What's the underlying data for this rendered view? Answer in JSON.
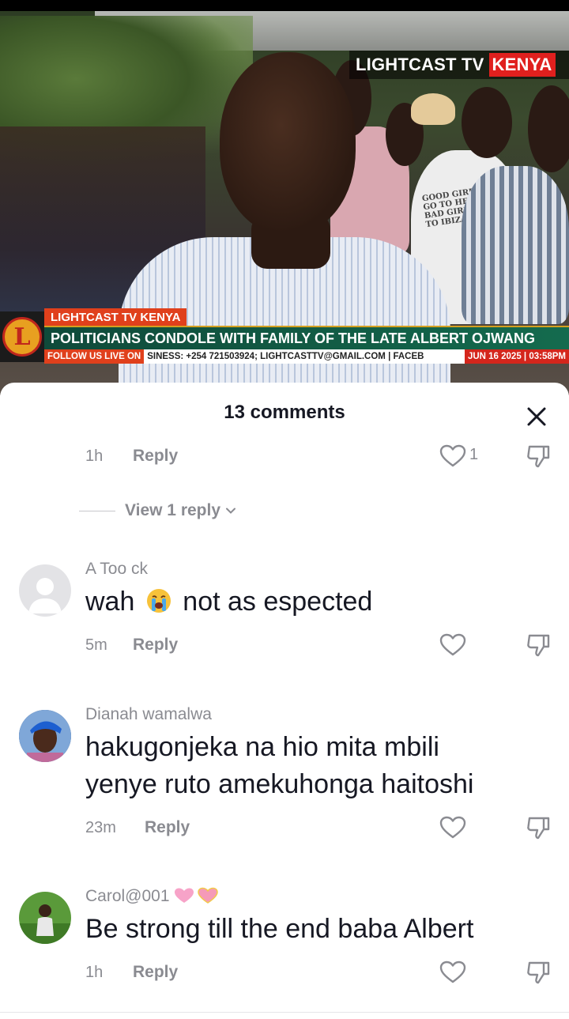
{
  "video": {
    "watermark_left": "LIGHTCAST TV",
    "watermark_right": "KENYA",
    "logo_letter": "L",
    "ticker_label": "LIGHTCAST TV KENYA",
    "headline": "POLITICIANS CONDOLE WITH FAMILY OF THE LATE ALBERT OJWANG",
    "follow": "FOLLOW US LIVE ON",
    "info": "SINESS: +254 721503924; LIGHTCASTTV@GMAIL.COM | FACEB",
    "date": "JUN 16 2025 | 03:58PM",
    "shirt_print": "GOOD GIRLS GO TO HEAVEN BAD GIRLS GO TO IBIZA"
  },
  "sheet": {
    "title": "13 comments",
    "close_icon": "close-icon"
  },
  "previous_comment": {
    "time": "1h",
    "reply_label": "Reply",
    "like_count": "1"
  },
  "view_replies": {
    "label": "View 1 reply"
  },
  "comments": [
    {
      "username": "A Too ck",
      "text_before": "wah",
      "emoji": "loudly-crying-face",
      "text_after": "not as espected",
      "time": "5m",
      "reply_label": "Reply"
    },
    {
      "username": "Dianah wamalwa",
      "text_line1": "hakugonjeka na hio mita mbili",
      "text_line2": "yenye ruto amekuhonga haitoshi",
      "time": "23m",
      "reply_label": "Reply"
    },
    {
      "username": "Carol@001",
      "username_emoji": "pink-hearts",
      "text": "Be strong till the end baba Albert",
      "time": "1h",
      "reply_label": "Reply"
    }
  ],
  "colors": {
    "accent_red": "#e0401c",
    "headline_green": "#146b4e",
    "text_primary": "#161823",
    "text_secondary": "#8a8b91"
  }
}
